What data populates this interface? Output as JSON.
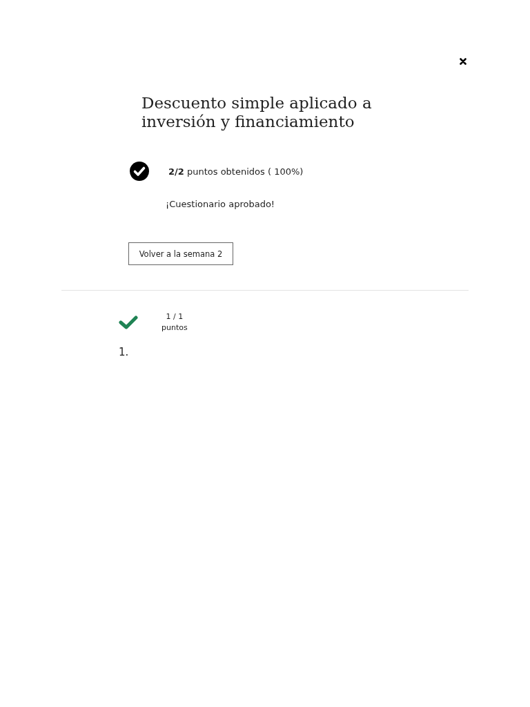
{
  "title": "Descuento simple aplicado a inversión y financiamiento",
  "result": {
    "passed": true,
    "score": "**2/2** puntos obtenidos ( 100%)",
    "message": "¡Cuestionario aprobado!"
  },
  "back_button": "Volver a la semana 2",
  "questions": [
    {
      "correct": true,
      "points": "1 / 1",
      "points_label": "puntos",
      "number": "1."
    }
  ]
}
